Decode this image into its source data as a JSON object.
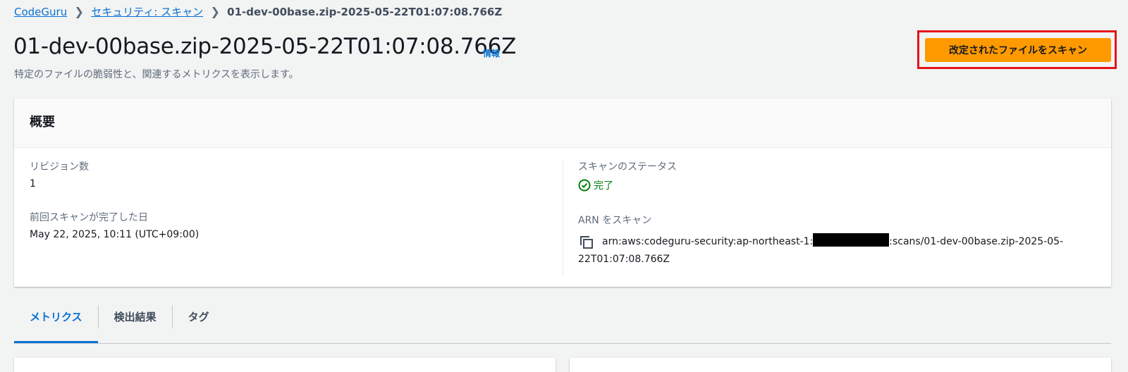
{
  "breadcrumb": {
    "items": [
      "CodeGuru",
      "セキュリティ: スキャン"
    ],
    "current": "01-dev-00base.zip-2025-05-22T01:07:08.766Z"
  },
  "header": {
    "title": "01-dev-00base.zip-2025-05-22T01:07:08.766Z",
    "info_label": "情報",
    "subtitle": "特定のファイルの脆弱性と、関連するメトリクスを表示します。",
    "scan_button_label": "改定されたファイルをスキャン"
  },
  "overview": {
    "heading": "概要",
    "revisions_label": "リビジョン数",
    "revisions_value": "1",
    "last_scan_label": "前回スキャンが完了した日",
    "last_scan_value": "May 22, 2025, 10:11 (UTC+09:00)",
    "status_label": "スキャンのステータス",
    "status_value": "完了",
    "arn_label": "ARN をスキャン",
    "arn_prefix": "arn:aws:codeguru-security:ap-northeast-1:",
    "arn_suffix": ":scans/01-dev-00base.zip-2025-05-",
    "arn_line2": "22T01:07:08.766Z"
  },
  "tabs": [
    "メトリクス",
    "検出結果",
    "タグ"
  ],
  "colors": {
    "accent": "#0972d3",
    "primary_button": "#ff9900",
    "success": "#037f0c",
    "highlight_outline": "#e4141b"
  }
}
